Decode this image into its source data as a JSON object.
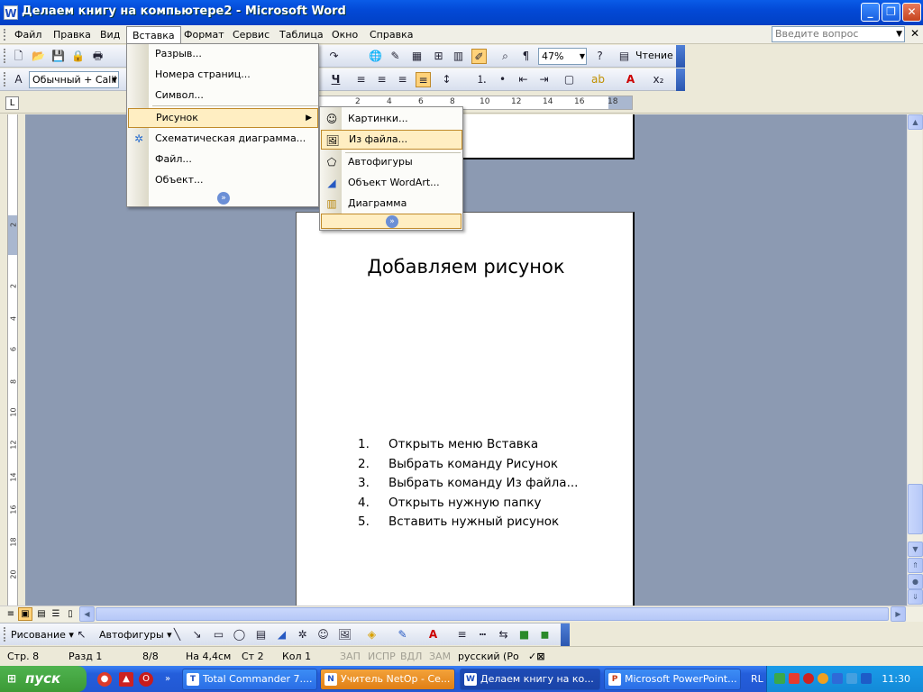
{
  "window": {
    "title": "Делаем книгу на компьютере2 - Microsoft Word",
    "app_icon": "W",
    "buttons": {
      "minimize": "_",
      "restore": "❐",
      "close": "✕"
    }
  },
  "menubar": {
    "items": [
      "Файл",
      "Правка",
      "Вид",
      "Вставка",
      "Формат",
      "Сервис",
      "Таблица",
      "Окно",
      "Справка"
    ],
    "active_index": 3,
    "ask_placeholder": "Введите вопрос"
  },
  "toolbar_standard": {
    "zoom": "47%",
    "reading_label": "Чтение",
    "paragraph_mark": "¶"
  },
  "toolbar_format": {
    "style": "Обычный + Calil",
    "underline": "Ч"
  },
  "ruler": {
    "ticks": [
      "2",
      "4",
      "6",
      "8",
      "10",
      "12",
      "14",
      "16",
      "18"
    ]
  },
  "vertical_ruler": {
    "ticks": [
      "2",
      "2",
      "4",
      "6",
      "8",
      "10",
      "12",
      "14",
      "16",
      "18",
      "20"
    ]
  },
  "insert_menu": {
    "items": [
      {
        "label": "Разрыв...",
        "icon": ""
      },
      {
        "label": "Номера страниц...",
        "icon": ""
      },
      {
        "label": "Символ...",
        "icon": ""
      },
      {
        "label": "Рисунок",
        "icon": "",
        "submenu": true
      },
      {
        "label": "Схематическая диаграмма...",
        "icon": "diagram-icon"
      },
      {
        "label": "Файл...",
        "icon": ""
      },
      {
        "label": "Объект...",
        "icon": ""
      }
    ],
    "highlighted_index": 3
  },
  "picture_submenu": {
    "items": [
      {
        "label": "Картинки...",
        "icon": "clipart-icon"
      },
      {
        "label": "Из файла...",
        "icon": "from-file-icon"
      },
      {
        "label": "Автофигуры",
        "icon": "autoshapes-icon"
      },
      {
        "label": "Объект WordArt...",
        "icon": "wordart-icon"
      },
      {
        "label": "Диаграмма",
        "icon": "chart-icon"
      }
    ],
    "highlighted_index": 1
  },
  "document": {
    "heading": "Добавляем рисунок",
    "steps": [
      {
        "num": "1.",
        "text": "Открыть меню Вставка"
      },
      {
        "num": "2.",
        "text": "Выбрать команду Рисунок"
      },
      {
        "num": "3.",
        "text": "Выбрать команду Из файла..."
      },
      {
        "num": "4.",
        "text": "Открыть нужную папку"
      },
      {
        "num": "5.",
        "text": "Вставить нужный рисунок"
      }
    ]
  },
  "drawing_toolbar": {
    "drawing_label": "Рисование ▾",
    "autoshapes_label": "Автофигуры ▾"
  },
  "statusbar": {
    "page": "Стр. 8",
    "section": "Разд 1",
    "pages": "8/8",
    "position": "На 4,4см",
    "line": "Ст 2",
    "column": "Кол 1",
    "rec": "ЗАП",
    "trk": "ИСПР",
    "ext": "ВДЛ",
    "ovr": "ЗАМ",
    "language": "русский (Ро"
  },
  "taskbar": {
    "start_label": "пуск",
    "tasks": [
      {
        "label": "Total Commander 7....",
        "icon": "T"
      },
      {
        "label": "Учитель NetOp - Се...",
        "icon": "N"
      },
      {
        "label": "Делаем книгу на ко...",
        "icon": "W"
      },
      {
        "label": "Microsoft PowerPoint...",
        "icon": "P"
      }
    ],
    "active_task": 2,
    "tray_lang": "RL",
    "clock": "11:30"
  },
  "colors": {
    "titlebar": "#0349d6",
    "menu_highlight": "#ffeec2",
    "doc_background": "#8c9ab2",
    "start_button": "#3c9a36"
  }
}
